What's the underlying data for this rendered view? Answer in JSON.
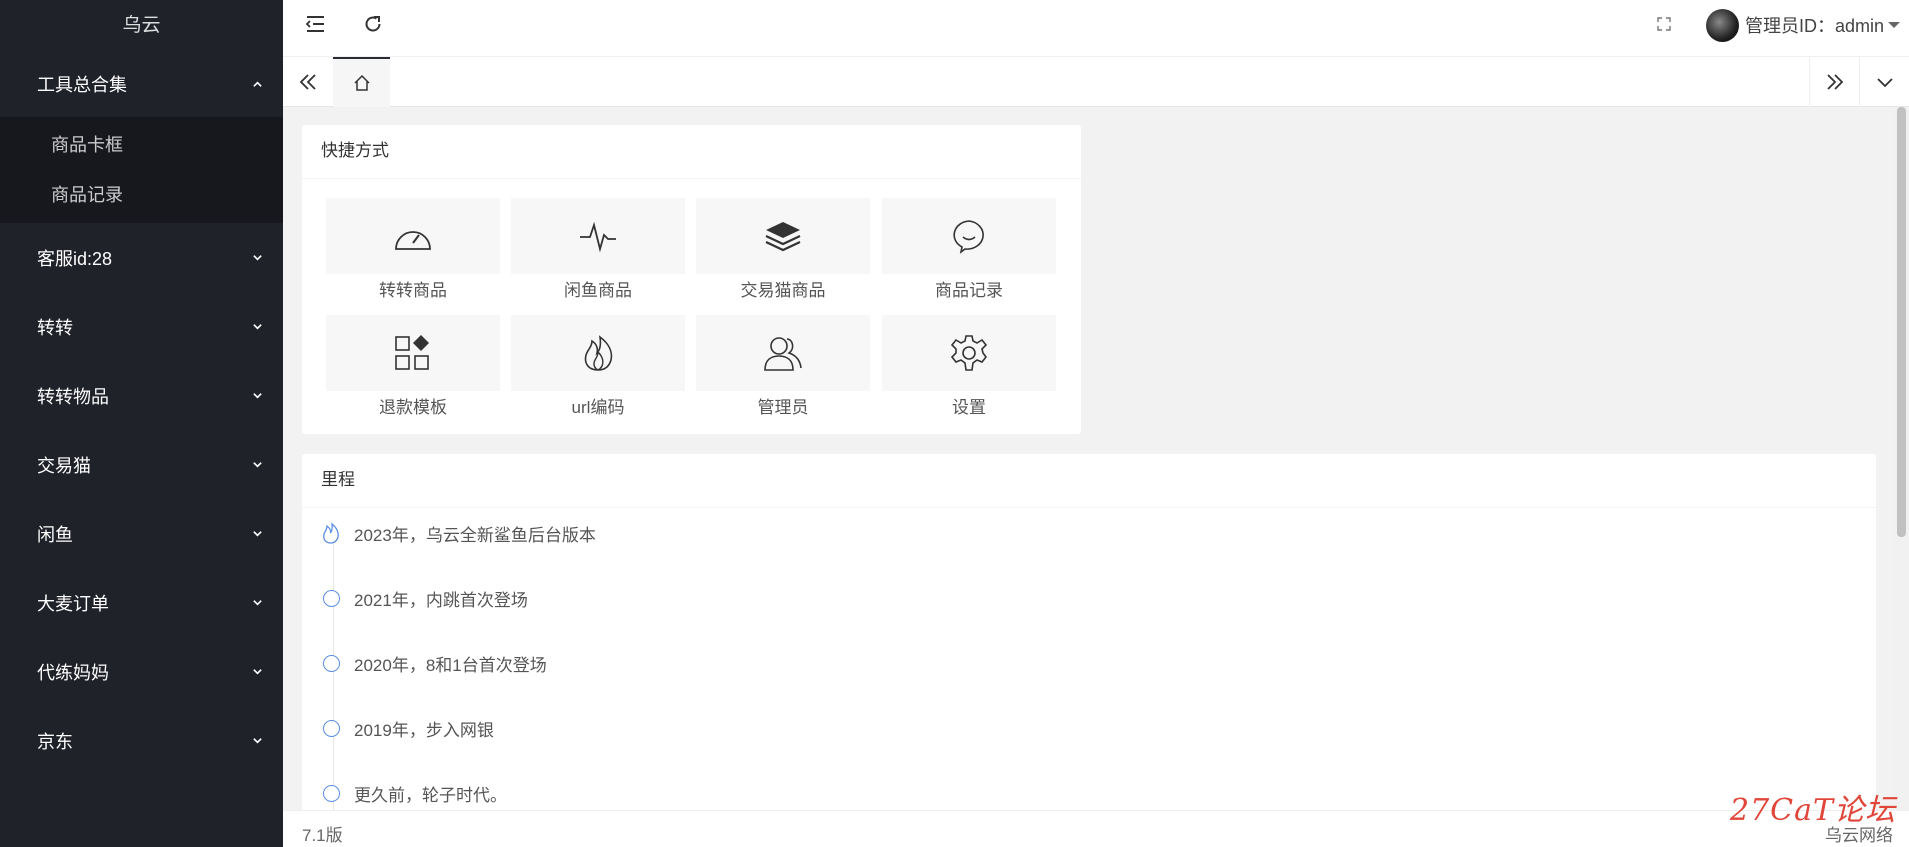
{
  "brand": "乌云",
  "sidebar": {
    "items": [
      {
        "label": "工具总合集",
        "expanded": true,
        "children": [
          "商品卡框",
          "商品记录"
        ]
      },
      {
        "label": "客服id:28"
      },
      {
        "label": "转转"
      },
      {
        "label": "转转物品"
      },
      {
        "label": "交易猫"
      },
      {
        "label": "闲鱼"
      },
      {
        "label": "大麦订单"
      },
      {
        "label": "代练妈妈"
      },
      {
        "label": "京东"
      }
    ]
  },
  "header": {
    "user_label": "管理员ID：admin",
    "icons": [
      "menu-fold-icon",
      "refresh-icon",
      "fullscreen-icon",
      "caret-down-icon"
    ]
  },
  "tabs": {
    "home_icon": "home-icon"
  },
  "shortcuts": {
    "title": "快捷方式",
    "items": [
      {
        "label": "转转商品",
        "icon": "dashboard-icon"
      },
      {
        "label": "闲鱼商品",
        "icon": "pulse-icon"
      },
      {
        "label": "交易猫商品",
        "icon": "layers-icon"
      },
      {
        "label": "商品记录",
        "icon": "chat-bubble-icon"
      },
      {
        "label": "退款模板",
        "icon": "template-icon"
      },
      {
        "label": "url编码",
        "icon": "fire-icon"
      },
      {
        "label": "管理员",
        "icon": "users-icon"
      },
      {
        "label": "设置",
        "icon": "gear-icon"
      }
    ]
  },
  "timeline": {
    "title": "里程",
    "items": [
      {
        "text": "2023年，乌云全新鲨鱼后台版本",
        "icon": "fire-icon"
      },
      {
        "text": "2021年，内跳首次登场",
        "icon": "circle-icon"
      },
      {
        "text": "2020年，8和1台首次登场",
        "icon": "circle-icon"
      },
      {
        "text": "2019年，步入网银",
        "icon": "circle-icon"
      },
      {
        "text": "更久前，轮子时代。",
        "icon": "circle-icon"
      }
    ]
  },
  "footer": {
    "version": "7.1版",
    "company": "乌云网络"
  },
  "watermark": "27CaT论坛",
  "colors": {
    "sidebar_bg": "#20222a",
    "submenu_bg": "#17181e",
    "timeline_accent": "#5b8fe0"
  }
}
